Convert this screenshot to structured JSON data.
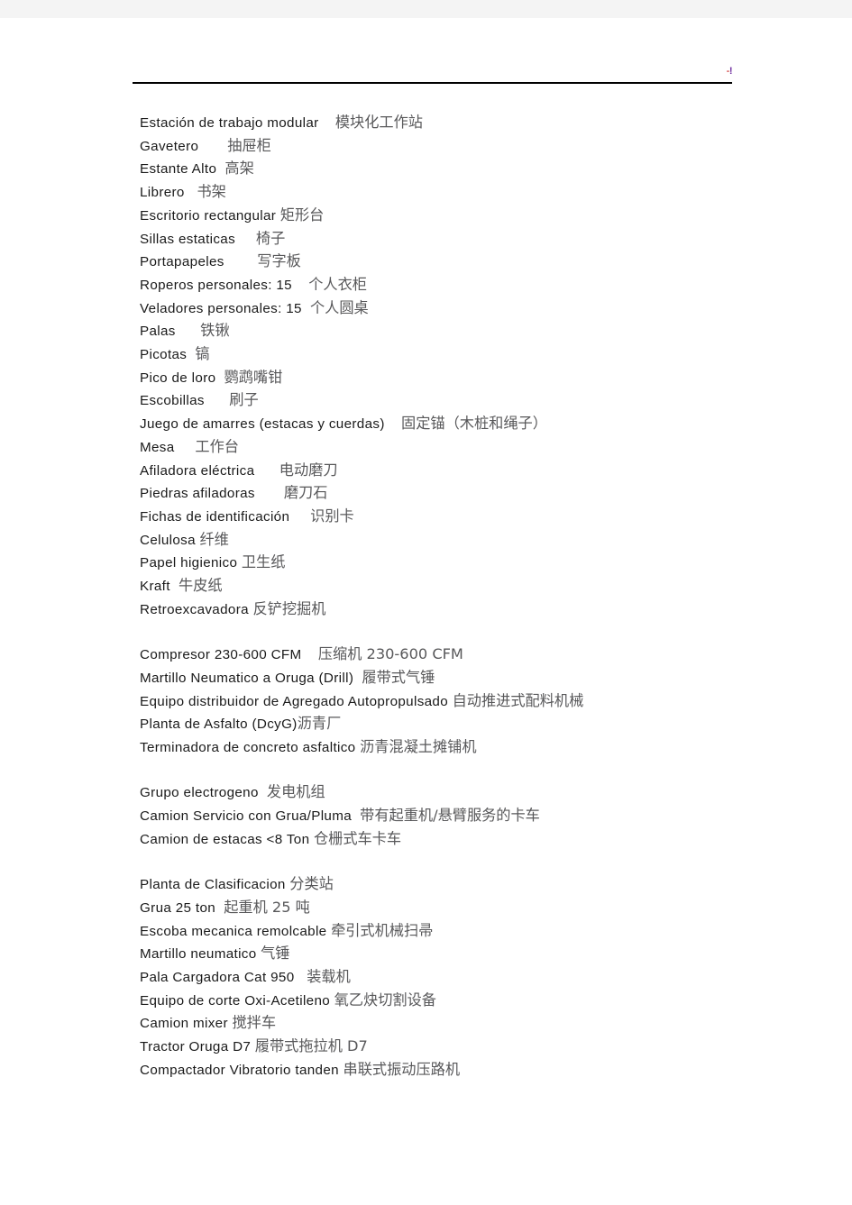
{
  "document": {
    "header": {
      "edit_mark_dash": "-",
      "edit_mark_bang": "!"
    },
    "blocks": [
      {
        "lines": [
          {
            "es": "Estación de trabajo modular",
            "gap": "    ",
            "zh": "模块化工作站"
          },
          {
            "es": "Gavetero",
            "gap": "       ",
            "zh": "抽屉柜"
          },
          {
            "es": "Estante Alto",
            "gap": "  ",
            "zh": "高架"
          },
          {
            "es": "Librero",
            "gap": "   ",
            "zh": "书架"
          },
          {
            "es": "Escritorio rectangular",
            "gap": " ",
            "zh": "矩形台"
          },
          {
            "es": "Sillas estaticas",
            "gap": "     ",
            "zh": "椅子"
          },
          {
            "es": "Portapapeles",
            "gap": "        ",
            "zh": "写字板"
          },
          {
            "es": "Roperos personales: 15",
            "gap": "    ",
            "zh": "个人衣柜"
          },
          {
            "es": "Veladores personales: 15",
            "gap": "  ",
            "zh": "个人圆桌"
          },
          {
            "es": "Palas",
            "gap": "      ",
            "zh": "铁锹"
          },
          {
            "es": "Picotas",
            "gap": "  ",
            "zh": "镐"
          },
          {
            "es": "Pico de loro",
            "gap": "  ",
            "zh": "鹦鹉嘴钳"
          },
          {
            "es": "Escobillas",
            "gap": "      ",
            "zh": "刷子"
          },
          {
            "es": "Juego de amarres (estacas y cuerdas)",
            "gap": "    ",
            "zh": "固定锚（木桩和绳子）"
          },
          {
            "es": "Mesa",
            "gap": "     ",
            "zh": "工作台"
          },
          {
            "es": "Afiladora eléctrica",
            "gap": "      ",
            "zh": "电动磨刀"
          },
          {
            "es": "Piedras afiladoras",
            "gap": "       ",
            "zh": "磨刀石"
          },
          {
            "es": "Fichas de identificación",
            "gap": "     ",
            "zh": "识别卡"
          },
          {
            "es": "Celulosa",
            "gap": " ",
            "zh": "纤维"
          },
          {
            "es": "Papel higienico",
            "gap": " ",
            "zh": "卫生纸"
          },
          {
            "es": "Kraft",
            "gap": "  ",
            "zh": "牛皮纸"
          },
          {
            "es": "Retroexcavadora",
            "gap": " ",
            "zh": "反铲挖掘机"
          }
        ]
      },
      {
        "lines": [
          {
            "es": "Compresor 230-600 CFM",
            "gap": "    ",
            "zh": "压缩机 230-600 CFM"
          },
          {
            "es": "Martillo Neumatico a Oruga (Drill)",
            "gap": "  ",
            "zh": "履带式气锤"
          },
          {
            "es": "Equipo distribuidor de Agregado Autopropulsado",
            "gap": " ",
            "zh": "自动推进式配料机械"
          },
          {
            "es": "Planta de Asfalto (DcyG)",
            "gap": "",
            "zh": "沥青厂"
          },
          {
            "es": "Terminadora de concreto asfaltico",
            "gap": " ",
            "zh": "沥青混凝土摊铺机"
          }
        ]
      },
      {
        "lines": [
          {
            "es": "Grupo electrogeno",
            "gap": "  ",
            "zh": "发电机组"
          },
          {
            "es": "Camion Servicio con Grua/Pluma",
            "gap": "  ",
            "zh": "带有起重机/悬臂服务的卡车"
          },
          {
            "es": "Camion de estacas <8 Ton",
            "gap": " ",
            "zh": "仓栅式车卡车"
          }
        ]
      },
      {
        "lines": [
          {
            "es": "Planta de Clasificacion",
            "gap": " ",
            "zh": "分类站"
          },
          {
            "es": "Grua 25 ton",
            "gap": "  ",
            "zh": "起重机 25 吨"
          },
          {
            "es": "Escoba mecanica remolcable",
            "gap": " ",
            "zh": "牵引式机械扫帚"
          },
          {
            "es": "Martillo neumatico",
            "gap": " ",
            "zh": "气锤"
          },
          {
            "es": "Pala Cargadora Cat 950",
            "gap": "   ",
            "zh": "装载机"
          },
          {
            "es": "Equipo de corte Oxi-Acetileno",
            "gap": " ",
            "zh": "氧乙炔切割设备"
          },
          {
            "es": "Camion mixer",
            "gap": " ",
            "zh": "搅拌车"
          },
          {
            "es": "Tractor Oruga D7",
            "gap": " ",
            "zh": "履带式拖拉机 D7"
          },
          {
            "es": "Compactador Vibratorio tanden",
            "gap": " ",
            "zh": "串联式振动压路机"
          }
        ]
      }
    ]
  }
}
